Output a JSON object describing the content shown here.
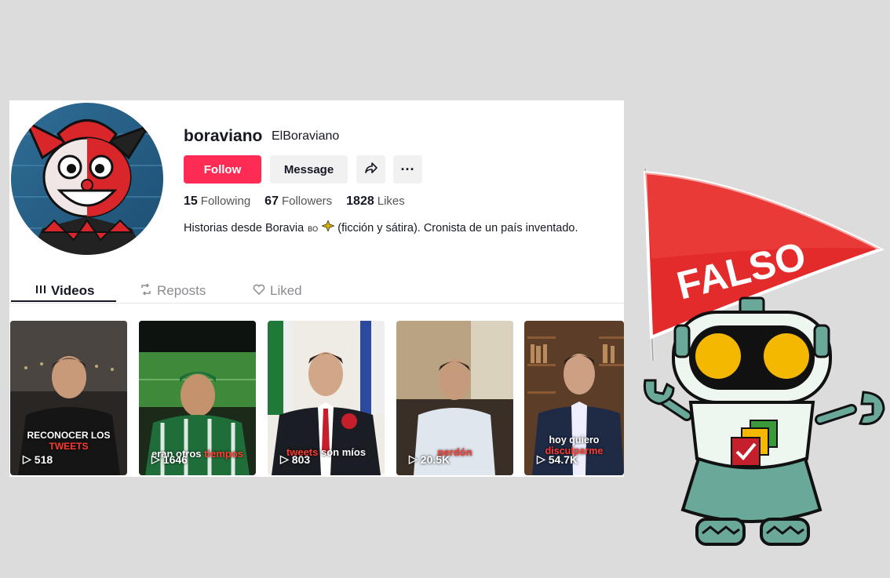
{
  "profile": {
    "username": "boraviano",
    "nickname": "ElBoraviano",
    "follow_label": "Follow",
    "message_label": "Message",
    "more_label": "···",
    "stats": [
      {
        "value": "15",
        "label": "Following"
      },
      {
        "value": "67",
        "label": "Followers"
      },
      {
        "value": "1828",
        "label": "Likes"
      }
    ],
    "bio_before": "Historias desde Boravia",
    "bio_flag": "BO",
    "bio_after": "(ficción y sátira). Cronista de un país inventado."
  },
  "tabs": [
    {
      "label": "Videos",
      "icon": "grid-bars-icon",
      "active": true
    },
    {
      "label": "Reposts",
      "icon": "repost-icon",
      "active": false
    },
    {
      "label": "Liked",
      "icon": "heart-icon",
      "active": false
    }
  ],
  "videos": [
    {
      "caption_white": "RECONOCER LOS",
      "caption_red": "TWEETS",
      "count": "518"
    },
    {
      "caption_white": "eran otros",
      "caption_red": "tiempos",
      "count": "1646"
    },
    {
      "caption_white": "son míos",
      "caption_red": "tweets",
      "count": "803"
    },
    {
      "caption_white": "",
      "caption_red": "perdón",
      "count": "20.5K"
    },
    {
      "caption_white": "hoy quiero",
      "caption_red": "disculparme",
      "count": "54.7K"
    }
  ],
  "sticker": {
    "flag_text": "FALSO",
    "colors": {
      "flag": "#e32b2b",
      "robot_body": "#6aa89a",
      "eyes": "#f5b800"
    }
  },
  "colors": {
    "accent": "#fe2c55"
  }
}
